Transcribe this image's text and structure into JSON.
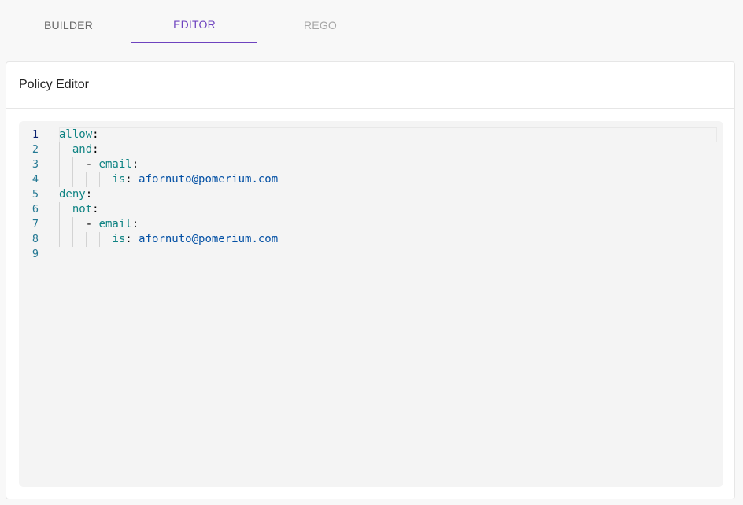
{
  "tabs": [
    {
      "label": "BUILDER"
    },
    {
      "label": "EDITOR"
    },
    {
      "label": "REGO"
    }
  ],
  "card": {
    "title": "Policy Editor"
  },
  "editor": {
    "line_numbers": [
      "1",
      "2",
      "3",
      "4",
      "5",
      "6",
      "7",
      "8",
      "9"
    ],
    "lines": [
      {
        "key": "allow",
        "colon": ":"
      },
      {
        "key": "and",
        "colon": ":"
      },
      {
        "dash": "- ",
        "key": "email",
        "colon": ":"
      },
      {
        "key": "is",
        "colon": ": ",
        "value": "afornuto@pomerium.com"
      },
      {
        "key": "deny",
        "colon": ":"
      },
      {
        "key": "not",
        "colon": ":"
      },
      {
        "dash": "- ",
        "key": "email",
        "colon": ":"
      },
      {
        "key": "is",
        "colon": ": ",
        "value": "afornuto@pomerium.com"
      },
      {}
    ]
  },
  "colors": {
    "accent": "#6e43bf",
    "key": "#0f8383",
    "value": "#0451a5",
    "line_number": "#237893"
  }
}
